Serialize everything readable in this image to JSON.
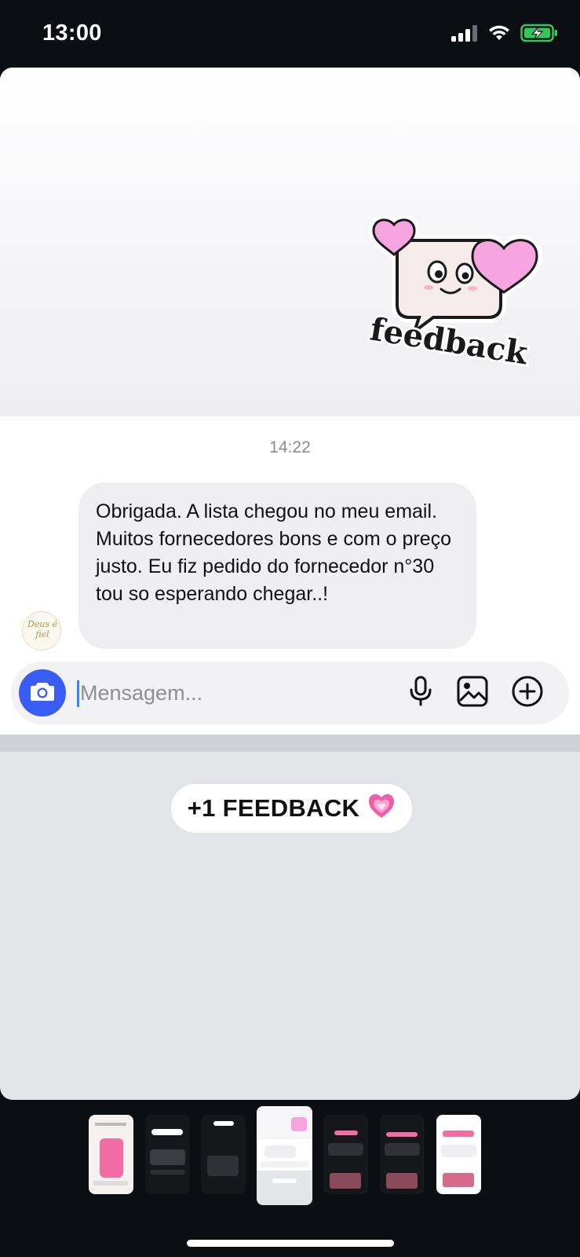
{
  "status_bar": {
    "time": "13:00",
    "icons": [
      "signal-icon",
      "wifi-icon",
      "battery-charging-icon"
    ]
  },
  "sticker": {
    "text": "feedback",
    "icons": [
      "speech-bubble-face-icon",
      "heart-icon"
    ],
    "colors": {
      "heart": "#f6a5e0",
      "outline": "#1a1a1a"
    }
  },
  "chat": {
    "timestamp": "14:22",
    "avatar_text": "Deus é fiel",
    "message": "Obrigada. A lista chegou no meu email. Muitos fornecedores bons e com o preço justo. Eu fiz pedido do fornecedor n°30 tou so esperando chegar..!"
  },
  "composer": {
    "placeholder": "Mensagem...",
    "value": "",
    "accent": "#3a5cf6",
    "icons": [
      "camera-icon",
      "microphone-icon",
      "gallery-icon",
      "add-circle-icon"
    ]
  },
  "banner": {
    "label": "+1 FEEDBACK",
    "emoji": "💗"
  },
  "thumbnails": {
    "count": 7,
    "selected": 4
  }
}
